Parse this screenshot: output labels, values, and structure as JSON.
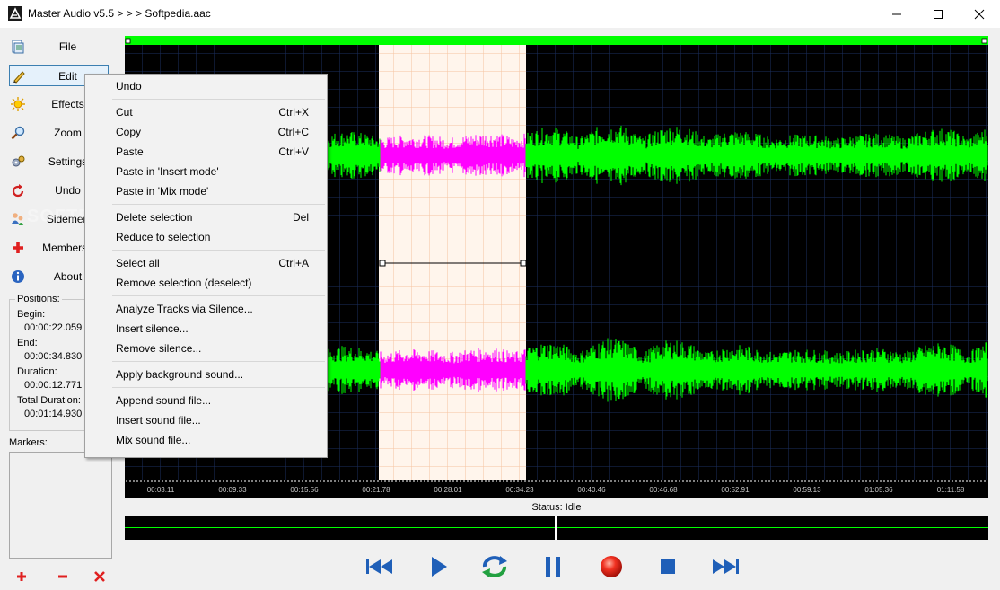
{
  "window": {
    "title": "Master Audio v5.5 > > > Softpedia.aac"
  },
  "sidebar": {
    "items": [
      {
        "label": "File"
      },
      {
        "label": "Edit"
      },
      {
        "label": "Effects"
      },
      {
        "label": "Zoom"
      },
      {
        "label": "Settings"
      },
      {
        "label": "Undo"
      },
      {
        "label": "Sidemen"
      },
      {
        "label": "Membersh"
      },
      {
        "label": "About"
      }
    ]
  },
  "positions": {
    "title": "Positions:",
    "begin_label": "Begin:",
    "begin": "00:00:22.059",
    "end_label": "End:",
    "end": "00:00:34.830",
    "duration_label": "Duration:",
    "duration": "00:00:12.771",
    "total_label": "Total Duration:",
    "total": "00:01:14.930"
  },
  "markers": {
    "title": "Markers:"
  },
  "menu": {
    "undo": "Undo",
    "cut": "Cut",
    "cut_sc": "Ctrl+X",
    "copy": "Copy",
    "copy_sc": "Ctrl+C",
    "paste": "Paste",
    "paste_sc": "Ctrl+V",
    "paste_insert": "Paste in 'Insert mode'",
    "paste_mix": "Paste in 'Mix mode'",
    "delete_sel": "Delete selection",
    "delete_sc": "Del",
    "reduce_sel": "Reduce to selection",
    "select_all": "Select all",
    "select_all_sc": "Ctrl+A",
    "remove_sel": "Remove selection (deselect)",
    "analyze": "Analyze Tracks via Silence...",
    "insert_silence": "Insert silence...",
    "remove_silence": "Remove silence...",
    "apply_bg": "Apply background sound...",
    "append_file": "Append sound file...",
    "insert_file": "Insert sound file...",
    "mix_file": "Mix sound file..."
  },
  "timeline": {
    "ticks": [
      "00:03.11",
      "00:09.33",
      "00:15.56",
      "00:21.78",
      "00:28.01",
      "00:34.23",
      "00:40.46",
      "00:46.68",
      "00:52.91",
      "00:59.13",
      "01:05.36",
      "01:11.58"
    ]
  },
  "status": {
    "text": "Status: Idle"
  },
  "watermark": "SOFTPEDIA",
  "colors": {
    "wave": "#00ff00",
    "selected_wave": "#ff00ff",
    "selection_bg": "#fff5ec",
    "progress": "#00ff00"
  }
}
